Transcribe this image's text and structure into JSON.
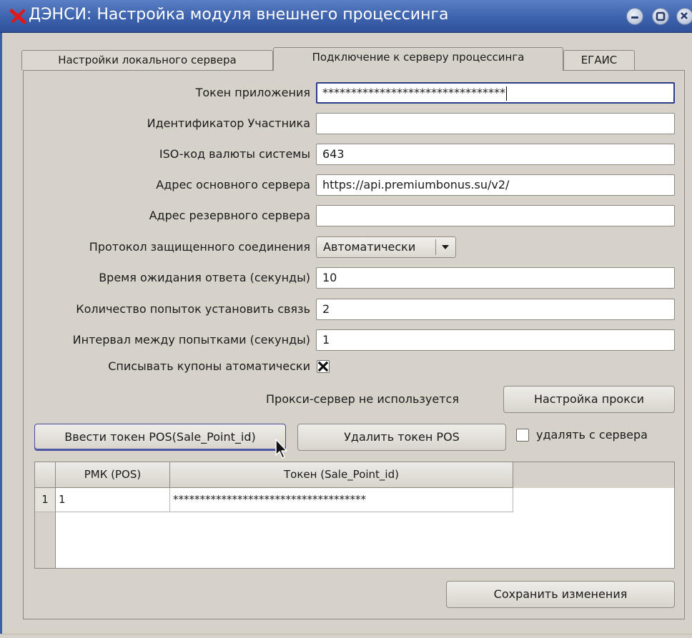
{
  "window": {
    "title": "ДЭНСИ: Настройка модуля внешнего процессинга"
  },
  "tabs": [
    {
      "label": "Настройки локального сервера",
      "active": false
    },
    {
      "label": "Подключение к серверу процессинга",
      "active": true
    },
    {
      "label": "ЕГАИС",
      "active": false
    }
  ],
  "form": {
    "app_token": {
      "label": "Токен приложения",
      "value": "********************************"
    },
    "participant_id": {
      "label": "Идентификатор Участника",
      "value": ""
    },
    "currency_code": {
      "label": "ISO-код валюты системы",
      "value": "643"
    },
    "main_server": {
      "label": "Адрес основного сервера",
      "value": "https://api.premiumbonus.su/v2/"
    },
    "reserve_server": {
      "label": "Адрес резервного сервера",
      "value": ""
    },
    "protocol": {
      "label": "Протокол защищенного соединения",
      "value": "Автоматически"
    },
    "timeout": {
      "label": "Время ожидания ответа (секунды)",
      "value": "10"
    },
    "attempts": {
      "label": "Количество попыток установить связь",
      "value": "2"
    },
    "interval": {
      "label": "Интервал между попытками (секунды)",
      "value": "1"
    },
    "auto_coupons": {
      "label": "Списывать купоны атоматически",
      "checked": true
    }
  },
  "proxy": {
    "status": "Прокси-сервер не используется",
    "button": "Настройка прокси"
  },
  "pos_token": {
    "enter_button": "Ввести токен POS(Sale_Point_id)",
    "delete_button": "Удалить токен POS",
    "delete_from_server": {
      "label": "удалять с сервера",
      "checked": false
    }
  },
  "table": {
    "columns": [
      "РМК (POS)",
      "Токен (Sale_Point_id)"
    ],
    "rows": [
      {
        "num": "1",
        "pos": "1",
        "token": "************************************"
      }
    ]
  },
  "save_button": "Сохранить изменения",
  "colors": {
    "titlebar": "#3d62ad",
    "background": "#d6d2ca",
    "focus_border": "#2c3e8a"
  }
}
